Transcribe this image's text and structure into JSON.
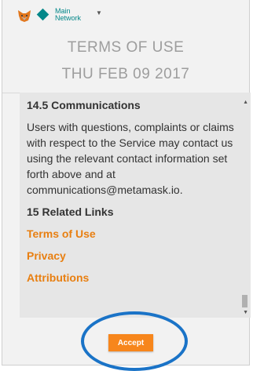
{
  "header": {
    "network_label": "Main Network",
    "title": "TERMS OF USE",
    "date": "THU FEB 09 2017"
  },
  "terms": {
    "section_heading": "14.5 Communications",
    "section_text": "Users with questions, complaints or claims with respect to the Service may contact us using the relevant contact information set forth above and at communications@metamask.io.",
    "links_heading": "15 Related Links",
    "links": [
      "Terms of Use",
      "Privacy",
      "Attributions"
    ]
  },
  "actions": {
    "accept_label": "Accept"
  },
  "colors": {
    "accent": "#f7861c",
    "link": "#e87f11",
    "network": "#038789",
    "annotation": "#1a73c7"
  },
  "icons": {
    "logo": "metamask-fox-icon",
    "network": "network-diamond-icon",
    "dropdown": "caret-down-icon",
    "scroll_up": "scroll-up-arrow-icon",
    "scroll_down": "scroll-down-arrow-icon"
  }
}
